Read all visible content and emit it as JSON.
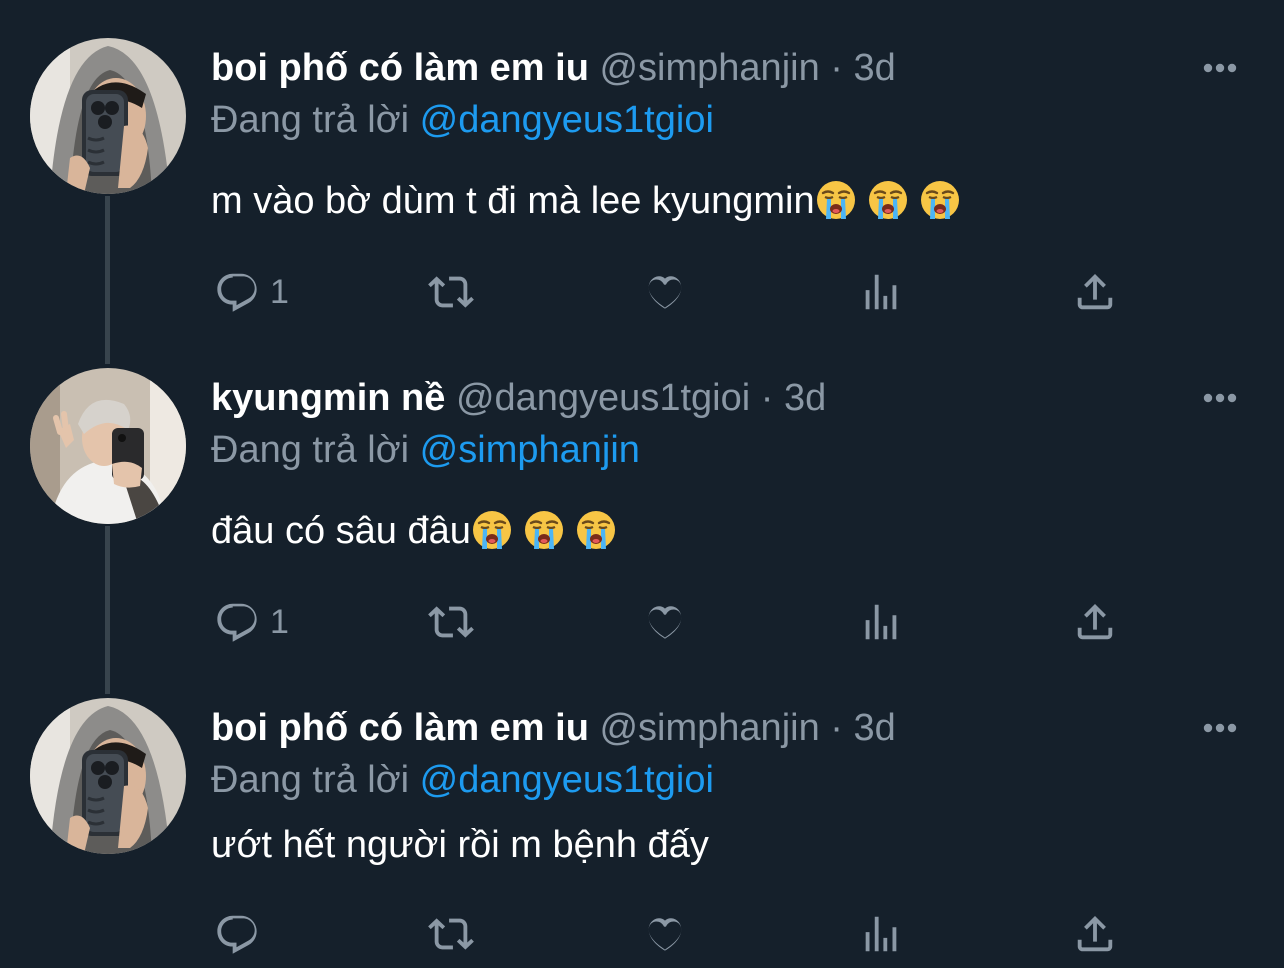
{
  "tweets": [
    {
      "name": "boi phố có làm em iu",
      "handle": "@simphanjin",
      "dot": "·",
      "time": "3d",
      "reply_prefix": "Đang trả lời",
      "reply_to": "@dangyeus1tgioi",
      "text": "m vào bờ dùm t đi mà lee kyungmin",
      "emojis": [
        "loudly-crying-face",
        "loudly-crying-face",
        "loudly-crying-face"
      ],
      "reply_count": "1",
      "retweet_count": "",
      "like_count": ""
    },
    {
      "name": "kyungmin nề",
      "handle": "@dangyeus1tgioi",
      "dot": "·",
      "time": "3d",
      "reply_prefix": "Đang trả lời",
      "reply_to": "@simphanjin",
      "text": "đâu có sâu đâu",
      "emojis": [
        "loudly-crying-face",
        "loudly-crying-face",
        "loudly-crying-face"
      ],
      "reply_count": "1",
      "retweet_count": "",
      "like_count": ""
    },
    {
      "name": "boi phố có làm em iu",
      "handle": "@simphanjin",
      "dot": "·",
      "time": "3d",
      "reply_prefix": "Đang trả lời",
      "reply_to": "@dangyeus1tgioi",
      "text": "ướt hết người rồi m bệnh đấy",
      "emojis": [],
      "reply_count": "",
      "retweet_count": "",
      "like_count": ""
    }
  ],
  "icons": {
    "reply": "reply-icon",
    "retweet": "retweet-icon",
    "like": "heart-icon",
    "views": "analytics-icon",
    "share": "share-icon",
    "more": "more-options-icon"
  },
  "colors": {
    "background": "#15202b",
    "text": "#ffffff",
    "secondary": "#8b98a5",
    "mention": "#1d9bf0",
    "thread_line": "#38444d"
  }
}
